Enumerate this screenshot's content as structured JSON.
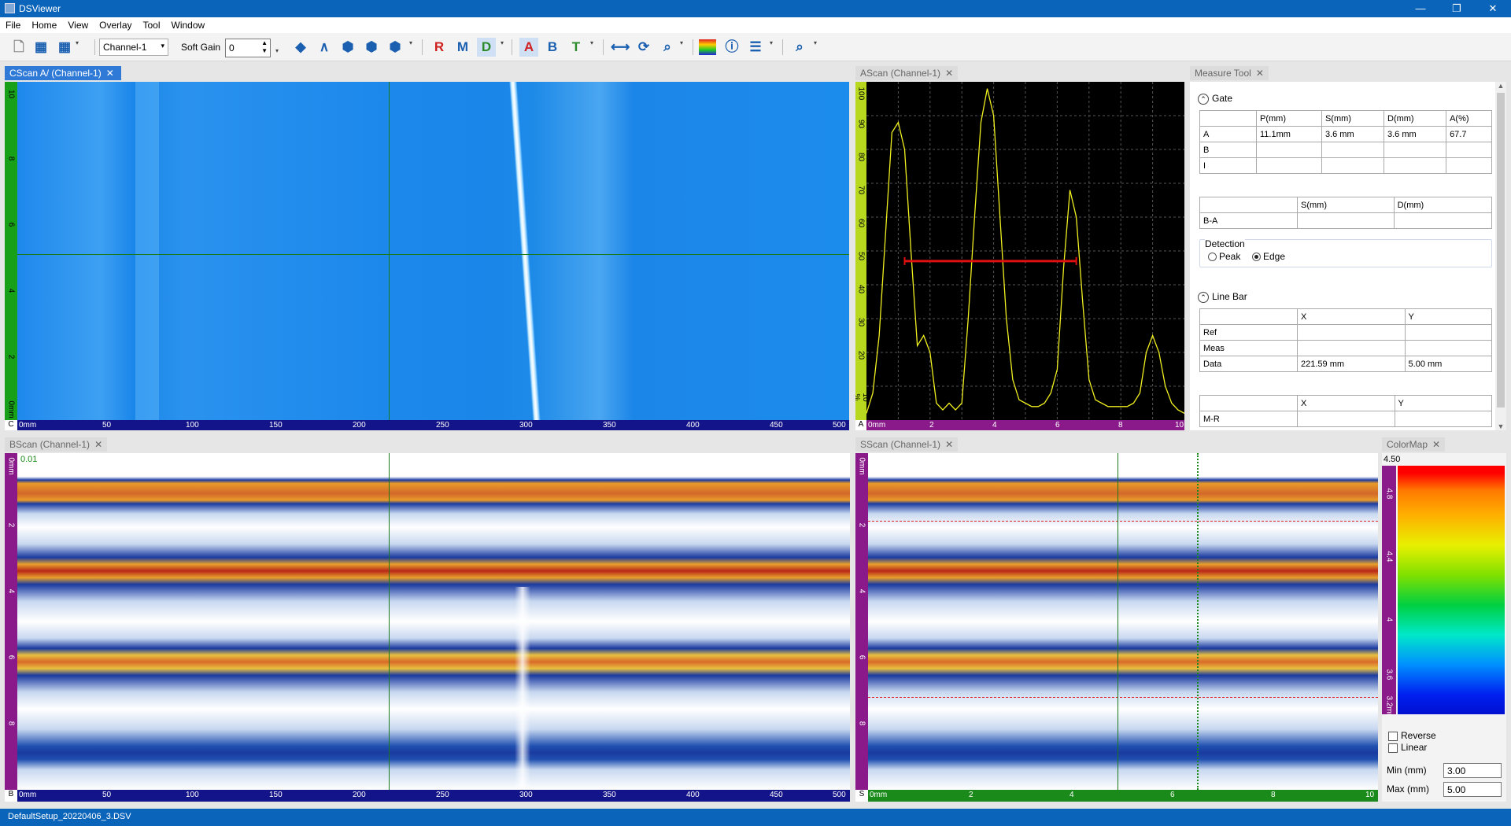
{
  "window": {
    "title": "DSViewer",
    "minimize": "—",
    "maximize": "❐",
    "close": "✕"
  },
  "menu": [
    "File",
    "Home",
    "View",
    "Overlay",
    "Tool",
    "Window"
  ],
  "toolbar": {
    "channel_select": "Channel-1",
    "soft_gain_label": "Soft Gain",
    "soft_gain_value": "0"
  },
  "tabs": {
    "cscan": "CScan A/ (Channel-1)",
    "ascan": "AScan (Channel-1)",
    "measure": "Measure Tool",
    "bscan": "BScan (Channel-1)",
    "sscan": "SScan (Channel-1)",
    "colormap": "ColorMap"
  },
  "cscan": {
    "v_corner": "C",
    "v_ticks": [
      "10",
      "8",
      "6",
      "4",
      "2",
      "0mm"
    ],
    "h_ticks": [
      "0mm",
      "50",
      "100",
      "150",
      "200",
      "250",
      "300",
      "350",
      "400",
      "450",
      "500"
    ]
  },
  "ascan": {
    "v_corner": "A",
    "v_ticks": [
      "100",
      "90",
      "80",
      "70",
      "60",
      "50",
      "40",
      "30",
      "20",
      "10 %"
    ],
    "h_ticks": [
      "0mm",
      "2",
      "4",
      "6",
      "8",
      "10"
    ]
  },
  "bscan": {
    "label": "0.01",
    "v_corner": "B",
    "v_ticks": [
      "0mm",
      "2",
      "4",
      "6",
      "8"
    ],
    "h_ticks": [
      "0mm",
      "50",
      "100",
      "150",
      "200",
      "250",
      "300",
      "350",
      "400",
      "450",
      "500"
    ]
  },
  "sscan": {
    "v_corner": "S",
    "v_ticks": [
      "0mm",
      "2",
      "4",
      "6",
      "8"
    ],
    "h_ticks": [
      "0mm",
      "2",
      "4",
      "6",
      "8",
      "10"
    ]
  },
  "measure": {
    "gate_title": "Gate",
    "gate_headers": [
      "",
      "P(mm)",
      "S(mm)",
      "D(mm)",
      "A(%)"
    ],
    "gate_rows": [
      [
        "A",
        "11.1mm",
        "3.6 mm",
        "3.6 mm",
        "67.7"
      ],
      [
        "B",
        "",
        "",
        "",
        ""
      ],
      [
        "I",
        "",
        "",
        "",
        ""
      ]
    ],
    "ba_headers": [
      "",
      "S(mm)",
      "D(mm)"
    ],
    "ba_rows": [
      [
        "B-A",
        "",
        ""
      ]
    ],
    "detection_title": "Detection",
    "detection_peak": "Peak",
    "detection_edge": "Edge",
    "linebar_title": "Line Bar",
    "lb_headers": [
      "",
      "X",
      "Y"
    ],
    "lb_rows": [
      [
        "Ref",
        "",
        ""
      ],
      [
        "Meas",
        "",
        ""
      ],
      [
        "Data",
        "221.59 mm",
        "5.00 mm"
      ]
    ],
    "mr_headers": [
      "",
      "X",
      "Y"
    ],
    "mr_rows": [
      [
        "M-R",
        "",
        ""
      ]
    ]
  },
  "colormap": {
    "top_value": "4.50",
    "ticks": [
      "4.8",
      "4.4",
      "4",
      "3.6",
      "3.2mm"
    ],
    "reverse": "Reverse",
    "linear": "Linear",
    "min_label": "Min (mm)",
    "min_value": "3.00",
    "max_label": "Max (mm)",
    "max_value": "5.00"
  },
  "status": {
    "file": "DefaultSetup_20220406_3.DSV"
  },
  "chart_data": {
    "type": "line",
    "title": "",
    "xlabel": "",
    "ylabel": "",
    "xlim": [
      0,
      10
    ],
    "ylim": [
      0,
      100
    ],
    "x": [
      0,
      0.2,
      0.4,
      0.6,
      0.8,
      1.0,
      1.2,
      1.4,
      1.6,
      1.8,
      2.0,
      2.2,
      2.4,
      2.6,
      2.8,
      3.0,
      3.2,
      3.4,
      3.6,
      3.8,
      4.0,
      4.2,
      4.4,
      4.6,
      4.8,
      5.0,
      5.2,
      5.4,
      5.6,
      5.8,
      6.0,
      6.2,
      6.4,
      6.6,
      6.8,
      7.0,
      7.2,
      7.4,
      7.6,
      7.8,
      8.0,
      8.2,
      8.4,
      8.6,
      8.8,
      9.0,
      9.2,
      9.4,
      9.6,
      9.8,
      10.0
    ],
    "series": [
      {
        "values": [
          2,
          8,
          25,
          55,
          85,
          88,
          80,
          50,
          22,
          25,
          20,
          5,
          3,
          5,
          3,
          5,
          30,
          60,
          88,
          98,
          90,
          60,
          30,
          12,
          6,
          5,
          4,
          4,
          5,
          8,
          15,
          45,
          68,
          60,
          35,
          12,
          6,
          5,
          4,
          4,
          4,
          4,
          5,
          8,
          20,
          25,
          20,
          10,
          5,
          3,
          2
        ]
      }
    ],
    "gate": {
      "start": 1.2,
      "end": 6.6,
      "level": 47,
      "color": "#e01010"
    }
  }
}
